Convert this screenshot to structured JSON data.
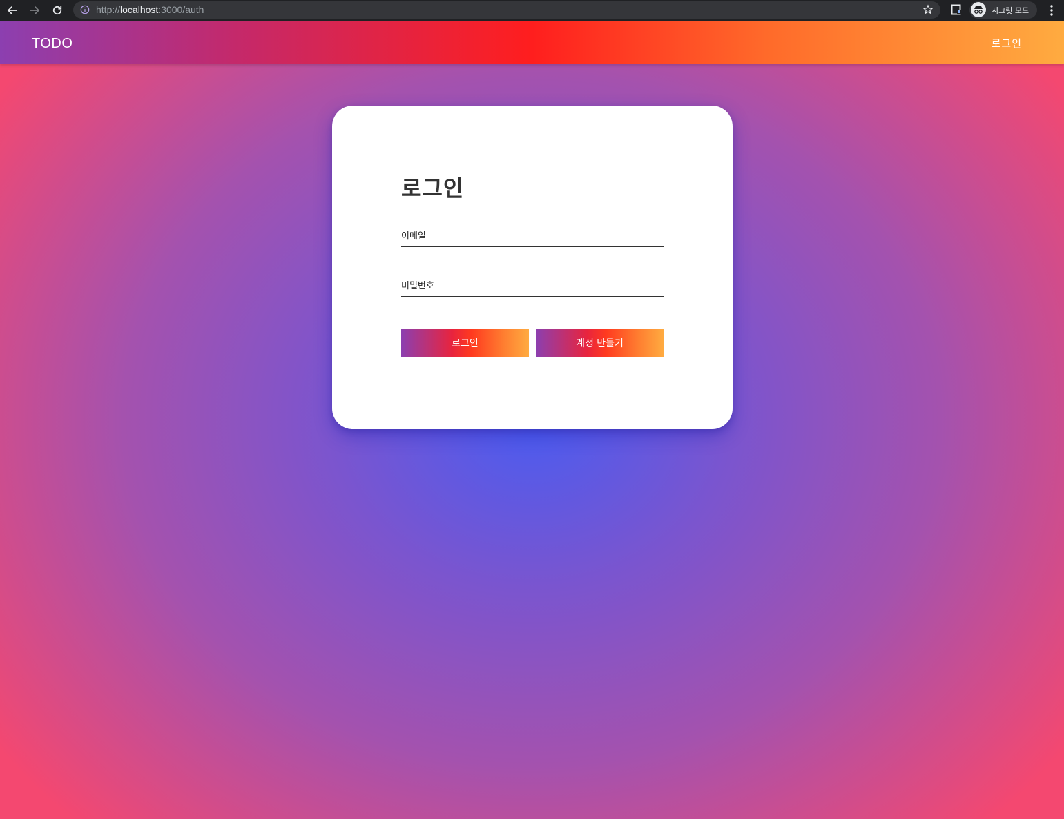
{
  "browser": {
    "url_scheme": "http://",
    "url_host": "localhost",
    "url_path": ":3000/auth",
    "incognito_label": "시크릿 모드",
    "icons": [
      "back-arrow-icon",
      "forward-arrow-icon",
      "reload-icon",
      "info-icon",
      "star-icon",
      "extension-icon",
      "incognito-icon",
      "menu-icon"
    ]
  },
  "appbar": {
    "brand": "TODO",
    "login_link": "로그인"
  },
  "login_form": {
    "title": "로그인",
    "email_placeholder": "이메일",
    "password_placeholder": "비밀번호",
    "login_button": "로그인",
    "signup_button": "계정 만들기"
  },
  "colors": {
    "appbar_gradient": [
      "#8c3fb0",
      "#ff1e1e",
      "#ffab40"
    ],
    "background_center": "#4a5cf0",
    "background_edge": "#f44870",
    "card": "#ffffff"
  }
}
